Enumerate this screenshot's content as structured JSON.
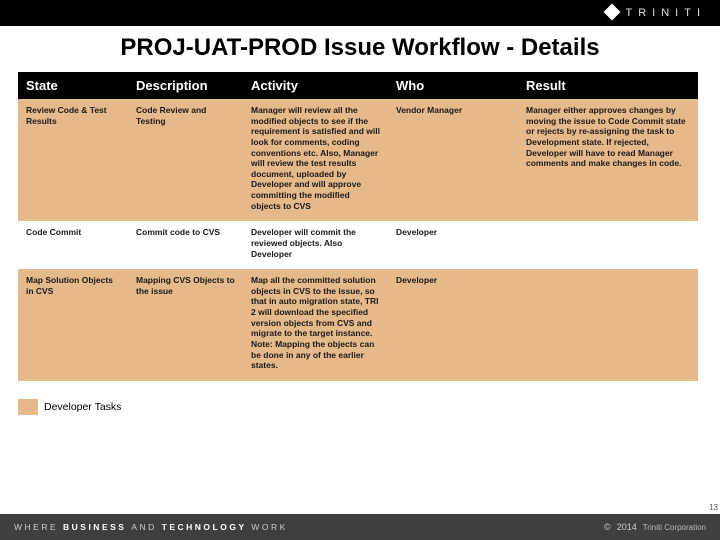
{
  "brand": {
    "name": "TRINITI"
  },
  "title": "PROJ-UAT-PROD Issue Workflow - Details",
  "columns": [
    "State",
    "Description",
    "Activity",
    "Who",
    "Result"
  ],
  "rows": [
    {
      "shade": "orange",
      "state": "Review Code & Test Results",
      "description": "Code Review and Testing",
      "activity": "Manager will review all the modified objects to see if the requirement is satisfied and will look for comments, coding conventions etc. Also, Manager will review the test results document, uploaded by Developer and will approve committing the modified objects to CVS",
      "who": "Vendor Manager",
      "result": "Manager either approves changes by moving the issue to Code Commit state or rejects by re-assigning the task to Development state. If rejected, Developer will have to read Manager comments and make changes in code."
    },
    {
      "shade": "white",
      "state": "Code Commit",
      "description": "Commit code to CVS",
      "activity": "Developer will commit the reviewed objects. Also Developer",
      "who": "Developer",
      "result": ""
    },
    {
      "shade": "orange",
      "state": "Map Solution Objects in CVS",
      "description": "Mapping CVS Objects to the issue",
      "activity": "Map all the committed solution objects in CVS to the issue, so that in auto migration state, TRI 2 will download the specified version objects from CVS and migrate to the target instance. Note: Mapping the objects can be done in any of the earlier states.",
      "who": "Developer",
      "result": ""
    }
  ],
  "legend": {
    "label": "Developer Tasks"
  },
  "footer": {
    "tagline_plain1": "WHERE ",
    "tagline_bold1": "BUSINESS ",
    "tagline_plain2": "AND ",
    "tagline_bold2": "TECHNOLOGY ",
    "tagline_plain3": "WORK",
    "copyright_symbol": "©",
    "year": "2014",
    "corp": "Triniti Corporation"
  },
  "pagenum": "13"
}
